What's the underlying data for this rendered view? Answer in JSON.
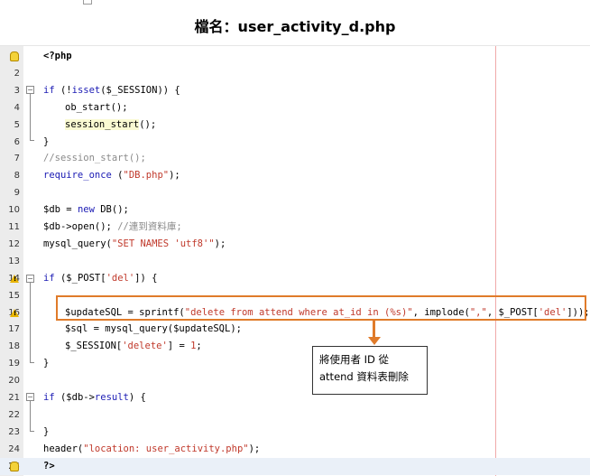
{
  "title": "檔名：user_activity_d.php",
  "lines": [
    {
      "n": "1",
      "tokens": [
        {
          "t": "<?php",
          "c": "b"
        }
      ]
    },
    {
      "n": "2",
      "tokens": []
    },
    {
      "n": "3",
      "tokens": [
        {
          "t": "if",
          "c": "kw"
        },
        {
          "t": " (!",
          "c": ""
        },
        {
          "t": "isset",
          "c": "kw"
        },
        {
          "t": "($_SESSION)) {",
          "c": ""
        }
      ]
    },
    {
      "n": "4",
      "tokens": [
        {
          "t": "ob_start();",
          "c": ""
        }
      ]
    },
    {
      "n": "5",
      "tokens": [
        {
          "t": "session_start",
          "c": "hl"
        },
        {
          "t": "();",
          "c": ""
        }
      ]
    },
    {
      "n": "6",
      "tokens": [
        {
          "t": "}",
          "c": ""
        }
      ]
    },
    {
      "n": "7",
      "tokens": [
        {
          "t": "//session_start();",
          "c": "cmt"
        }
      ]
    },
    {
      "n": "8",
      "tokens": [
        {
          "t": "require_once",
          "c": "kw"
        },
        {
          "t": " (",
          "c": ""
        },
        {
          "t": "\"DB.php\"",
          "c": "str"
        },
        {
          "t": ");",
          "c": ""
        }
      ]
    },
    {
      "n": "9",
      "tokens": []
    },
    {
      "n": "10",
      "tokens": [
        {
          "t": "$db = ",
          "c": ""
        },
        {
          "t": "new",
          "c": "kw"
        },
        {
          "t": " DB();",
          "c": ""
        }
      ]
    },
    {
      "n": "11",
      "tokens": [
        {
          "t": "$db->open(); ",
          "c": ""
        },
        {
          "t": "//連到資料庫;",
          "c": "cmt"
        }
      ]
    },
    {
      "n": "12",
      "tokens": [
        {
          "t": "mysql_query(",
          "c": ""
        },
        {
          "t": "\"SET NAMES 'utf8'\"",
          "c": "str"
        },
        {
          "t": ");",
          "c": ""
        }
      ]
    },
    {
      "n": "13",
      "tokens": []
    },
    {
      "n": "14",
      "tokens": [
        {
          "t": "if",
          "c": "kw"
        },
        {
          "t": " ($_POST[",
          "c": ""
        },
        {
          "t": "'del'",
          "c": "str"
        },
        {
          "t": "]) {",
          "c": ""
        }
      ]
    },
    {
      "n": "15",
      "tokens": []
    },
    {
      "n": "16",
      "tokens": [
        {
          "t": "$updateSQL = sprintf(",
          "c": ""
        },
        {
          "t": "\"delete from attend where at_id in (%s)\"",
          "c": "str"
        },
        {
          "t": ", implode(",
          "c": ""
        },
        {
          "t": "\",\"",
          "c": "str"
        },
        {
          "t": ", $_POST[",
          "c": ""
        },
        {
          "t": "'del'",
          "c": "str"
        },
        {
          "t": "]));",
          "c": ""
        }
      ]
    },
    {
      "n": "17",
      "tokens": [
        {
          "t": "$sql = mysql_query($updateSQL);",
          "c": ""
        }
      ]
    },
    {
      "n": "18",
      "tokens": [
        {
          "t": "$_SESSION[",
          "c": ""
        },
        {
          "t": "'delete'",
          "c": "str"
        },
        {
          "t": "] = ",
          "c": ""
        },
        {
          "t": "1",
          "c": "str"
        },
        {
          "t": ";",
          "c": ""
        }
      ]
    },
    {
      "n": "19",
      "tokens": [
        {
          "t": "}",
          "c": ""
        }
      ]
    },
    {
      "n": "20",
      "tokens": []
    },
    {
      "n": "21",
      "tokens": [
        {
          "t": "if",
          "c": "kw"
        },
        {
          "t": " ($db->",
          "c": ""
        },
        {
          "t": "result",
          "c": "kw"
        },
        {
          "t": ") {",
          "c": ""
        }
      ]
    },
    {
      "n": "22",
      "tokens": []
    },
    {
      "n": "23",
      "tokens": [
        {
          "t": "}",
          "c": ""
        }
      ]
    },
    {
      "n": "24",
      "tokens": [
        {
          "t": "header(",
          "c": ""
        },
        {
          "t": "\"location: user_activity.php\"",
          "c": "str"
        },
        {
          "t": ");",
          "c": ""
        }
      ]
    },
    {
      "n": "25",
      "tokens": [
        {
          "t": "?>",
          "c": "b"
        }
      ]
    }
  ],
  "indent_lines": [
    "4",
    "5",
    "16",
    "17",
    "18"
  ],
  "gutter_icons": {
    "1": "lightbulb-icon",
    "14": "warning-icon",
    "16": "warning-icon",
    "25": "lightbulb-icon"
  },
  "callout": {
    "line1": "將使用者 ID 從",
    "line2": "attend 資料表刪除"
  },
  "colors": {
    "accent": "#e07b2a",
    "keyword": "#1b1bb4",
    "string": "#c0392b",
    "comment": "#8a8a8a",
    "margin": "#f0a9a9"
  }
}
